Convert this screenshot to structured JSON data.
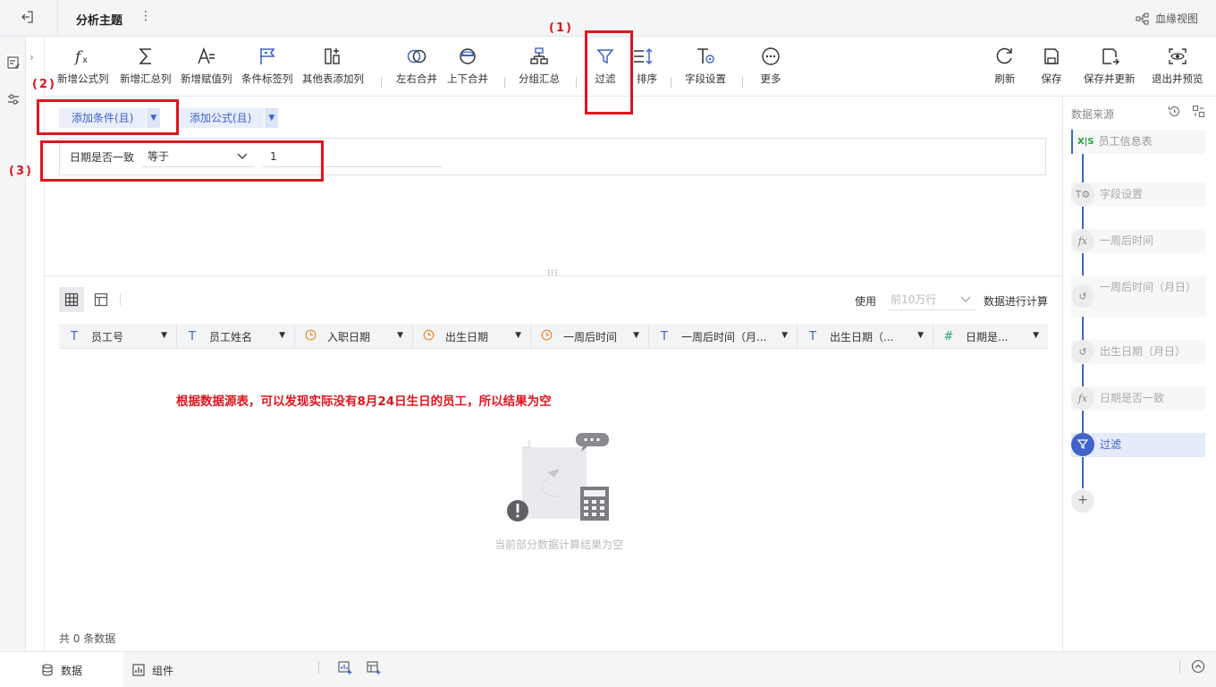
{
  "header": {
    "title": "分析主题",
    "lineage_label": "血缘视图"
  },
  "toolbar": {
    "items": [
      {
        "label": "新增公式列"
      },
      {
        "label": "新增汇总列"
      },
      {
        "label": "新增赋值列"
      },
      {
        "label": "条件标签列"
      },
      {
        "label": "其他表添加列"
      },
      {
        "label": "左右合并"
      },
      {
        "label": "上下合并"
      },
      {
        "label": "分组汇总"
      },
      {
        "label": "过滤"
      },
      {
        "label": "排序"
      },
      {
        "label": "字段设置"
      },
      {
        "label": "更多"
      }
    ],
    "right": [
      {
        "label": "刷新"
      },
      {
        "label": "保存"
      },
      {
        "label": "保存并更新"
      },
      {
        "label": "退出并预览"
      }
    ]
  },
  "annotations": {
    "n1": "(1)",
    "n2": "(2)",
    "n3": "(3)",
    "note": "根据数据源表，可以发现实际没有8月24日生日的员工，所以结果为空"
  },
  "filter": {
    "add_condition": "添加条件(且)",
    "add_formula": "添加公式(且)",
    "condition": {
      "field": "日期是否一致",
      "operator": "等于",
      "value": "1"
    }
  },
  "data_view": {
    "use_label": "使用",
    "use_placeholder": "前10万行",
    "use_suffix": "数据进行计算",
    "columns": [
      {
        "name": "员工号",
        "type": "text"
      },
      {
        "name": "员工姓名",
        "type": "text"
      },
      {
        "name": "入职日期",
        "type": "date"
      },
      {
        "name": "出生日期",
        "type": "date"
      },
      {
        "name": "一周后时间",
        "type": "date"
      },
      {
        "name": "一周后时间（月...",
        "type": "text"
      },
      {
        "name": "出生日期（...",
        "type": "text"
      },
      {
        "name": "日期是...",
        "type": "number"
      }
    ],
    "empty_message": "当前部分数据计算结果为空",
    "total": "共 0 条数据"
  },
  "right_panel": {
    "title": "数据来源",
    "steps": [
      {
        "name": "员工信息表",
        "icon": "xls"
      },
      {
        "name": "字段设置",
        "icon": "field-settings"
      },
      {
        "name": "一周后时间",
        "icon": "formula"
      },
      {
        "name": "一周后时间（月日）",
        "icon": "history"
      },
      {
        "name": "出生日期（月日）",
        "icon": "history"
      },
      {
        "name": "日期是否一致",
        "icon": "formula"
      },
      {
        "name": "过滤",
        "icon": "filter"
      }
    ]
  },
  "bottom": {
    "tab_data": "数据",
    "tab_component": "组件"
  },
  "colors": {
    "accent": "#3f63c8",
    "annotation": "#e0141e"
  }
}
